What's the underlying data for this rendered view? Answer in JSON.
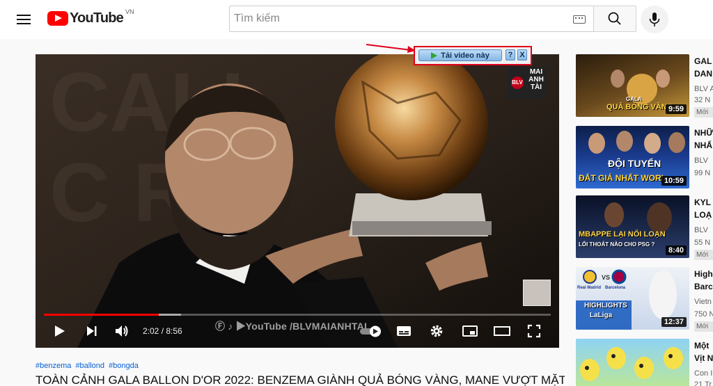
{
  "header": {
    "logo_text": "YouTube",
    "logo_country": "VN",
    "search_placeholder": "Tìm kiếm"
  },
  "player": {
    "channel_watermark": "MAI ANH TÀI",
    "channel_badge": "BLV",
    "watermark": "Ⓕ ♪ ▶YouTube /BLVMAIANHTAI",
    "time": "2:02 / 8:56",
    "progress": 0.226,
    "buffered": 0.27
  },
  "download_bar": {
    "label": "Tải video này",
    "help": "?",
    "close": "X"
  },
  "video": {
    "tags": [
      "#benzema",
      "#ballond",
      "#bongda"
    ],
    "title": "TOÀN CẢNH GALA BALLON D'OR 2022: BENZEMA GIÀNH QUẢ BÓNG VÀNG, MANE VƯỢT MẶT"
  },
  "recommendations": [
    {
      "title_line1": "GAL",
      "title_line2": "DAN",
      "channel": "BLV A",
      "views": "32 N",
      "badge": "Mới",
      "duration": "9:59",
      "caption_top": "GALA",
      "caption_bottom": "QUẢ BÓNG VÀNG",
      "colors": [
        "#6b4a1e",
        "#c89a3a",
        "#2b1d0c"
      ]
    },
    {
      "title_line1": "NHỮ",
      "title_line2": "NHẤ",
      "channel": "BLV",
      "views": "99 N",
      "badge": "",
      "duration": "10:59",
      "caption_top": "ĐỘI TUYỂN",
      "caption_bottom": "ĐẮT GIÁ NHẤT WORL",
      "colors": [
        "#1b3c8f",
        "#2e6bd1",
        "#0d1f4a"
      ]
    },
    {
      "title_line1": "KYL",
      "title_line2": "LOẠ",
      "channel": "BLV",
      "views": "55 N",
      "badge": "Mới",
      "duration": "8:40",
      "caption_top": "MBAPPE LẠI NỔI LOẠN",
      "caption_bottom": "LỐI THOÁT NÀO CHO PSG ?",
      "colors": [
        "#12203f",
        "#2a3d6b",
        "#0a1127"
      ]
    },
    {
      "title_line1": "High",
      "title_line2": "Barc",
      "channel": "Vietn",
      "views": "750 N",
      "badge": "Mới",
      "duration": "12:37",
      "caption_top": "HIGHLIGHTS",
      "caption_bottom": "LaLiga",
      "team_left": "Real Madrid",
      "team_right": "Barcelona",
      "colors": [
        "#eef2f7",
        "#1f5fbf",
        "#c9d6ea"
      ]
    },
    {
      "title_line1": "Một",
      "title_line2": "Vịt N",
      "channel": "Con I",
      "views": "21 Tr",
      "badge": "",
      "duration": "",
      "caption_top": "",
      "caption_bottom": "",
      "colors": [
        "#8fd3f4",
        "#c6ec7d",
        "#f6e04a"
      ]
    }
  ]
}
